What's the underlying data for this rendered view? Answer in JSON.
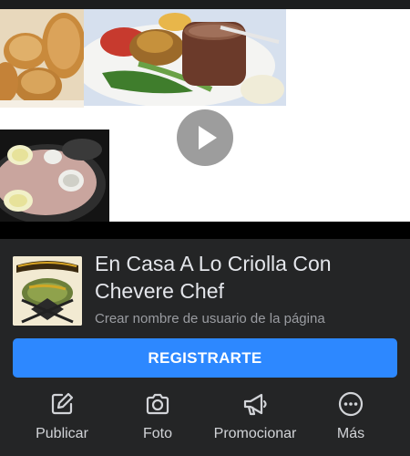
{
  "post": {
    "video_play_icon": "play-icon"
  },
  "page": {
    "name": "En Casa A Lo Criolla Con Chevere Chef",
    "username_hint": "Crear nombre de usuario de la página",
    "avatar_icon": "page-logo"
  },
  "register_button": {
    "label": "REGISTRARTE",
    "color": "#2d88ff"
  },
  "actions": [
    {
      "label": "Publicar",
      "icon": "edit-icon"
    },
    {
      "label": "Foto",
      "icon": "camera-icon"
    },
    {
      "label": "Promocionar",
      "icon": "megaphone-icon"
    },
    {
      "label": "Más",
      "icon": "more-icon"
    }
  ],
  "theme": {
    "background": "#242526",
    "text": "#e4e6eb",
    "muted_text": "#9a9ca1"
  }
}
